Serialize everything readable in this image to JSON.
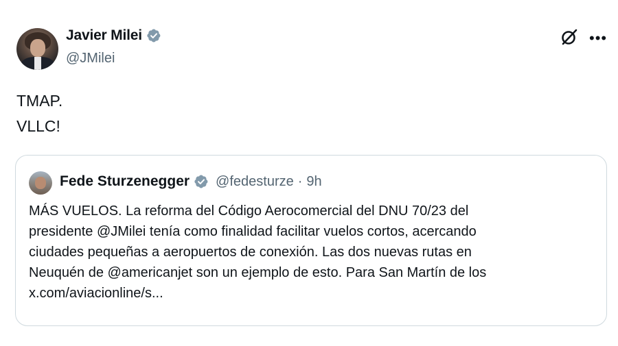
{
  "post": {
    "author": {
      "display_name": "Javier Milei",
      "handle": "@JMilei",
      "verified": true
    },
    "text_lines": [
      "TMAP.",
      "VLLC!"
    ],
    "actions": {
      "grok_icon": "grok-icon",
      "more_icon": "more-icon"
    }
  },
  "quoted_post": {
    "author": {
      "display_name": "Fede Sturzenegger",
      "handle": "@fedesturze",
      "separator": "·",
      "time": "9h",
      "verified": true
    },
    "text_lines": [
      "MÁS VUELOS. La reforma del Código Aerocomercial del DNU 70/23 del",
      "presidente @JMilei tenía como finalidad facilitar vuelos cortos, acercando",
      "ciudades pequeñas a aeropuertos de conexión. Las dos nuevas rutas en",
      "Neuquén de @americanjet son un ejemplo de esto. Para San Martín de los",
      "x.com/aviacionline/s..."
    ]
  },
  "colors": {
    "text": "#0f1419",
    "secondary_text": "#536471",
    "border": "#cfd9de",
    "verified_badge": "#829aab"
  }
}
